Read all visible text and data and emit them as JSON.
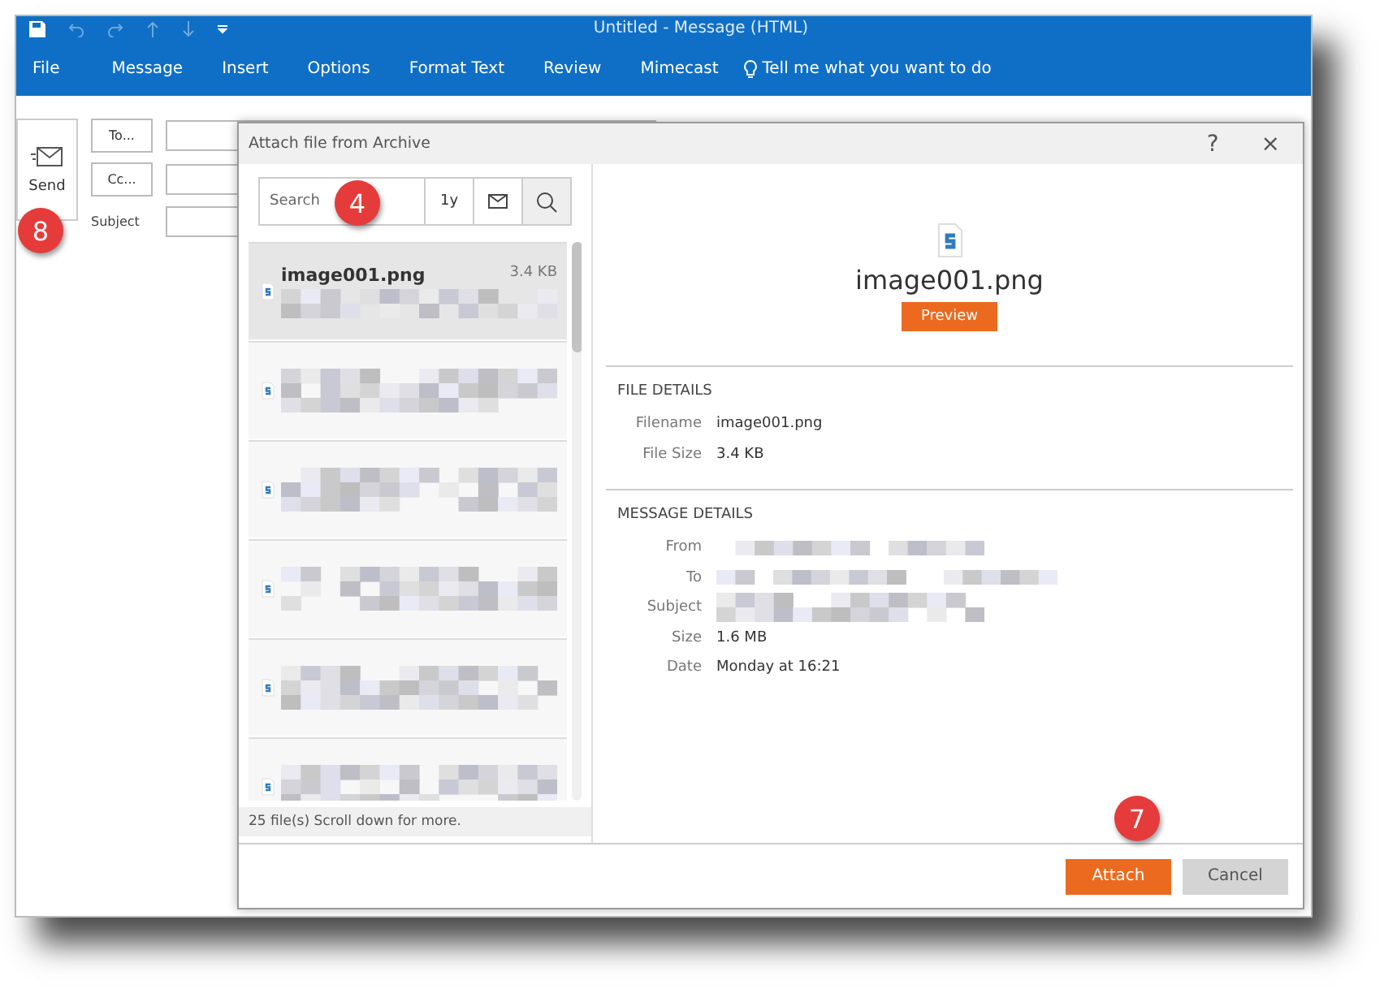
{
  "window": {
    "title": "Untitled  -  Message (HTML)"
  },
  "ribbon_tabs": [
    {
      "label": "File"
    },
    {
      "label": "Message"
    },
    {
      "label": "Insert"
    },
    {
      "label": "Options"
    },
    {
      "label": "Format Text"
    },
    {
      "label": "Review"
    },
    {
      "label": "Mimecast"
    }
  ],
  "tell_me": "Tell me what you want to do",
  "compose": {
    "send": "Send",
    "to": "To...",
    "cc": "Cc...",
    "subject": "Subject"
  },
  "dialog": {
    "title": "Attach file from Archive",
    "help": "?",
    "close": "×",
    "search": {
      "placeholder": "Search",
      "range": "1y"
    },
    "files": [
      {
        "name": "image001.png",
        "size": "3.4 KB",
        "selected": true,
        "redacted": true
      },
      {
        "selected": false,
        "redacted": true
      },
      {
        "selected": false,
        "redacted": true
      },
      {
        "selected": false,
        "redacted": true
      },
      {
        "selected": false,
        "redacted": true
      },
      {
        "selected": false,
        "redacted": true
      }
    ],
    "status": "25 file(s) Scroll down for more.",
    "preview": {
      "filename": "image001.png",
      "button": "Preview"
    },
    "file_details": {
      "heading": "FILE DETAILS",
      "rows": [
        {
          "label": "Filename",
          "value": "image001.png"
        },
        {
          "label": "File Size",
          "value": "3.4 KB"
        }
      ]
    },
    "message_details": {
      "heading": "MESSAGE DETAILS",
      "rows": [
        {
          "label": "From",
          "redacted": true
        },
        {
          "label": "To",
          "redacted": true
        },
        {
          "label": "Subject",
          "redacted": true
        },
        {
          "label": "Size",
          "value": "1.6 MB"
        },
        {
          "label": "Date",
          "value": "Monday at 16:21"
        }
      ]
    },
    "buttons": [
      {
        "label": "Attach",
        "kind": "primary"
      },
      {
        "label": "Cancel",
        "kind": "secondary"
      }
    ]
  },
  "callouts": [
    {
      "number": "8"
    },
    {
      "number": "4"
    },
    {
      "number": "7"
    }
  ]
}
